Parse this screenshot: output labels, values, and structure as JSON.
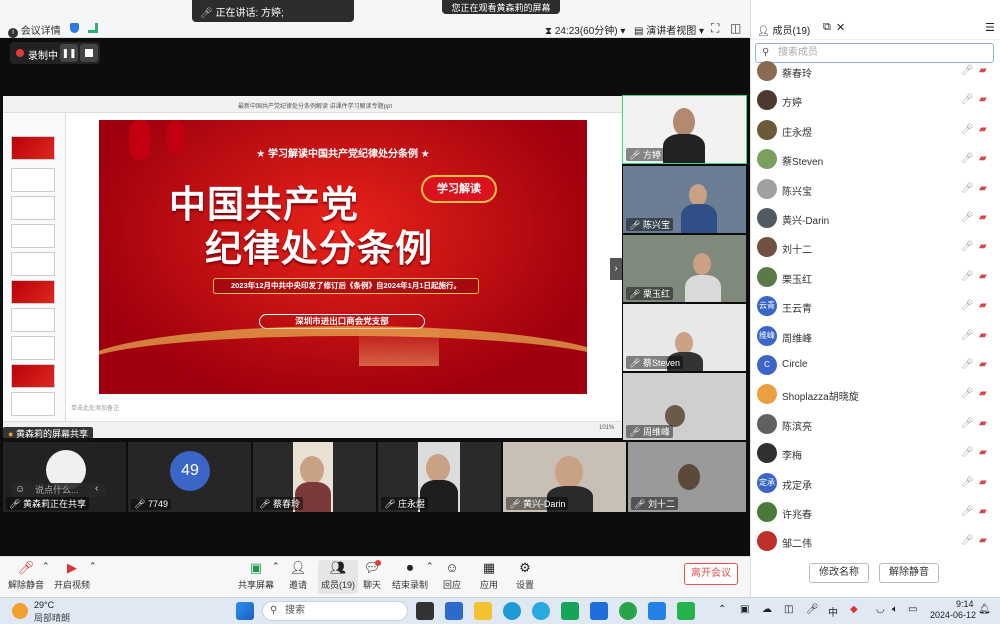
{
  "topbar": {
    "meeting_info": "会议详情",
    "speaking_label": "正在讲话:",
    "speaking_name": "方婷;",
    "watching_notice": "您正在观看黄森莉的屏幕",
    "timer": "24:23(60分钟)",
    "view_mode": "演讲者视图"
  },
  "recording": {
    "label": "录制中"
  },
  "shared_doc": {
    "window_title": "最新中国共产党纪律处分条例解读 讲课件学习解读专题ppt",
    "notes_placeholder": "单击此处添加备注",
    "zoom": "101%",
    "slide": {
      "subtitle": "学习解读中国共产党纪律处分条例",
      "title_line1": "中国共产党",
      "title_line2": "纪律处分条例",
      "badge": "学习解读",
      "notice": "2023年12月中共中央印发了修订后《条例》自2024年1月1日起施行。",
      "org": "深圳市进出口商会党支部"
    }
  },
  "share_label": "黄森莉的屏幕共享",
  "right_tiles": [
    {
      "name": "方婷"
    },
    {
      "name": "陈兴宝"
    },
    {
      "name": "栗玉红"
    },
    {
      "name": "蔡Steven"
    },
    {
      "name": "周维峰"
    }
  ],
  "bottom_tiles": [
    {
      "name": "黄森莉正在共享",
      "chat_placeholder": "说点什么..."
    },
    {
      "name": "7749",
      "avatar_text": "49"
    },
    {
      "name": "蔡春玲"
    },
    {
      "name": "庄永煜"
    },
    {
      "name": "黄兴-Darin"
    },
    {
      "name": "刘十二"
    }
  ],
  "toolbar": {
    "mute": "解除静音",
    "video": "开启视频",
    "share": "共享屏幕",
    "invite": "邀请",
    "members": "成员(19)",
    "chat": "聊天",
    "chat_badge": "",
    "stop_record": "结束录制",
    "react": "回应",
    "apps": "应用",
    "settings": "设置",
    "leave": "离开会议"
  },
  "panel": {
    "title": "成员(19)",
    "search_placeholder": "搜索成员",
    "members": [
      {
        "name": "蔡春玲",
        "avatar": "",
        "color": "#8a6a50"
      },
      {
        "name": "方婷",
        "avatar": "",
        "color": "#4a3a30"
      },
      {
        "name": "庄永煜",
        "avatar": "",
        "color": "#6b5a3a"
      },
      {
        "name": "蔡Steven",
        "avatar": "",
        "color": "#7aa060"
      },
      {
        "name": "陈兴宝",
        "avatar": "",
        "color": "#a0a0a0"
      },
      {
        "name": "黄兴-Darin",
        "avatar": "",
        "color": "#505a60"
      },
      {
        "name": "刘十二",
        "avatar": "",
        "color": "#705040"
      },
      {
        "name": "栗玉红",
        "avatar": "",
        "color": "#5a7a4a"
      },
      {
        "name": "王云青",
        "avatar": "云青",
        "color": "#3b66c7"
      },
      {
        "name": "周维峰",
        "avatar": "维峰",
        "color": "#3b66c7"
      },
      {
        "name": "Circle",
        "avatar": "C",
        "color": "#3b66c7"
      },
      {
        "name": "Shoplazza胡晓旋",
        "avatar": "",
        "color": "#e8a040"
      },
      {
        "name": "陈滨亮",
        "avatar": "",
        "color": "#606060"
      },
      {
        "name": "李梅",
        "avatar": "",
        "color": "#303030"
      },
      {
        "name": "戎定承",
        "avatar": "定承",
        "color": "#3b66c7"
      },
      {
        "name": "许兆春",
        "avatar": "",
        "color": "#4a7a3a"
      },
      {
        "name": "邹二伟",
        "avatar": "",
        "color": "#c0302a"
      }
    ],
    "rename": "修改名称",
    "unmute_all": "解除静音"
  },
  "taskbar": {
    "temperature": "29°C",
    "weather": "局部晴朗",
    "search": "搜索",
    "time": "9:14",
    "date": "2024-06-12",
    "ime": "中"
  }
}
